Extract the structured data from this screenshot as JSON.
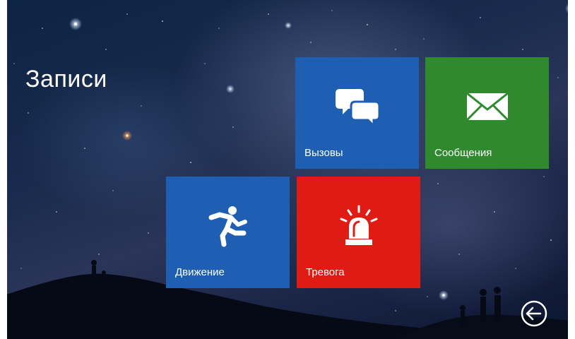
{
  "page": {
    "title": "Записи"
  },
  "tiles": [
    {
      "id": "calls",
      "label": "Вызовы",
      "icon": "chat-bubbles-icon",
      "color": "#1e5fb4"
    },
    {
      "id": "messages",
      "label": "Сообщения",
      "icon": "envelope-icon",
      "color": "#2f8a2e"
    },
    {
      "id": "motion",
      "label": "Движение",
      "icon": "running-man-icon",
      "color": "#1e5fb4"
    },
    {
      "id": "alarm",
      "label": "Тревога",
      "icon": "siren-icon",
      "color": "#e01b14"
    }
  ],
  "navigation": {
    "back_icon": "back-arrow-icon"
  },
  "colors": {
    "accent_blue": "#1e5fb4",
    "accent_green": "#2f8a2e",
    "accent_red": "#e01b14",
    "text": "#ffffff"
  }
}
